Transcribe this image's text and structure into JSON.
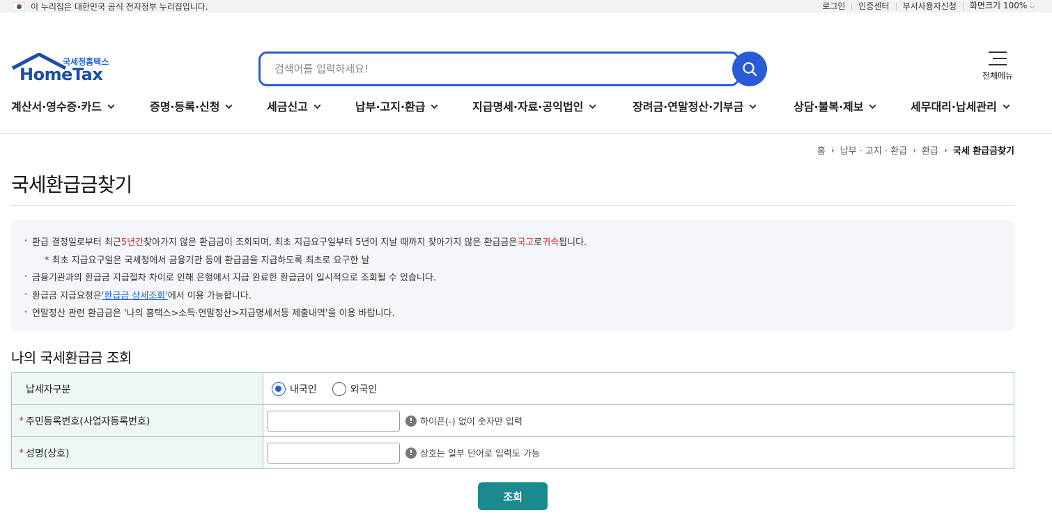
{
  "topbar": {
    "notice": "이 누리집은 대한민국 공식 전자정부 누리집입니다.",
    "links": [
      "로그인",
      "인증센터",
      "부서사용자신청",
      "화면크기"
    ],
    "zoom": "100%"
  },
  "logo": {
    "sub": "국세청홈택스",
    "main": "HomeTax"
  },
  "search": {
    "placeholder": "검색어를 입력하세요!"
  },
  "allmenu": {
    "label": "전체메뉴"
  },
  "gnb": [
    "계산서·영수증·카드",
    "증명·등록·신청",
    "세금신고",
    "납부·고지·환급",
    "지급명세·자료·공익법인",
    "장려금·연말정산·기부금",
    "상담·불복·제보",
    "세무대리·납세관리"
  ],
  "breadcrumb": [
    "홈",
    "납부 · 고지 · 환급",
    "환급",
    "국세 환급금찾기"
  ],
  "page_title": "국세환급금찾기",
  "info": {
    "l1_a": "환급 결정일로부터 최근 ",
    "l1_red1": "5년간",
    "l1_b": " 찾아가지 않은 환급금이 조회되며, 최초 지급요구일부터 5년이 지날 때까지 찾아가지 않은 환급금은 ",
    "l1_red2": "국고",
    "l1_c": "로 ",
    "l1_red3": "귀속",
    "l1_d": "됩니다.",
    "l2": "* 최초 지급요구일은 국세청에서 금융기관 등에 환급금을 지급하도록 최초로 요구한 날",
    "l3": "금융기관과의 환급금 지급절차 차이로 인해 은행에서 지급 완료한 환급금이 일시적으로 조회될 수 있습니다.",
    "l4_a": "환급금 지급요청은 ",
    "l4_link": "'환급금 상세조회'",
    "l4_b": "에서 이용 가능합니다.",
    "l5": "연말정산 관련 환급금은 '나의 홈택스>소득·연말정산>지급명세서등 제출내역'을 이용 바랍니다."
  },
  "section_title": "나의 국세환급금 조회",
  "form": {
    "taxpayer_type_label": "납세자구분",
    "radio_domestic": "내국인",
    "radio_foreign": "외국인",
    "selected": "내국인",
    "rrn_label": "주민등록번호(사업자등록번호)",
    "rrn_hint": "하이픈(-) 없이 숫자만 입력",
    "name_label": "성명(상호)",
    "name_hint": "상호는 일부 단어로 입력도 가능",
    "required_mark": "*",
    "hint_mark": "!"
  },
  "submit_label": "조회"
}
